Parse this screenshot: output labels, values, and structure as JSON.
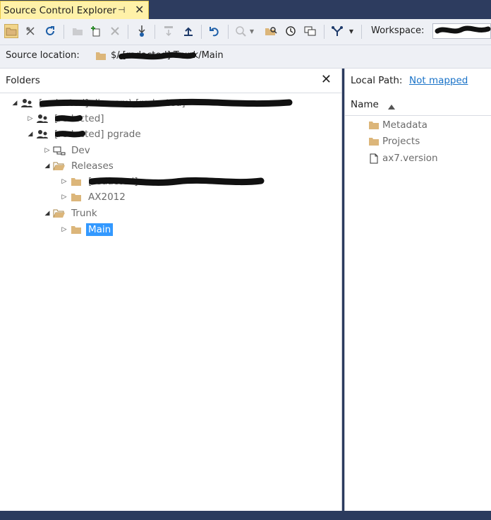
{
  "tab": {
    "title": "Source Control Explorer",
    "pin_glyph": "⊣",
    "close_glyph": "✕"
  },
  "toolbar": {
    "workspace_label": "Workspace:",
    "workspace_value": "",
    "icons": [
      "folder-view-icon",
      "disconnect-icon",
      "refresh-icon",
      "new-folder-icon",
      "add-items-icon",
      "delete-icon",
      "get-latest-icon",
      "check-in-pending-icon",
      "check-in-icon",
      "undo-icon",
      "compare-icon",
      "find-icon",
      "history-icon",
      "workspaces-icon",
      "branch-icon"
    ]
  },
  "source": {
    "label": "Source location:",
    "path": "$/ [redacted] Trunk/Main"
  },
  "folders": {
    "title": "Folders",
    "close_glyph": "✕",
    "tree": [
      {
        "label": "[redacted] dio.com\\ [redacted]",
        "icon": "team-project-collection-icon",
        "arrow": "◢",
        "expanded": true
      },
      {
        "label": "[redacted]",
        "icon": "team-project-icon",
        "arrow": "▷",
        "expanded": false
      },
      {
        "label": "[redacted] pgrade",
        "icon": "team-project-icon",
        "arrow": "◢",
        "expanded": true
      },
      {
        "label": "Dev",
        "icon": "branch-folder-icon",
        "arrow": "▷",
        "expanded": false
      },
      {
        "label": "Releases",
        "icon": "open-folder-icon",
        "arrow": "◢",
        "expanded": true
      },
      {
        "label": "[redacted]",
        "icon": "folder-icon",
        "arrow": "▷",
        "expanded": false
      },
      {
        "label": "AX2012",
        "icon": "folder-icon",
        "arrow": "▷",
        "expanded": false
      },
      {
        "label": "Trunk",
        "icon": "open-folder-icon",
        "arrow": "◢",
        "expanded": true
      },
      {
        "label": "Main",
        "icon": "folder-icon",
        "arrow": "▷",
        "expanded": false,
        "selected": true
      }
    ]
  },
  "local": {
    "label": "Local Path:",
    "link": "Not mapped",
    "column": "Name",
    "sort_glyph": "▲",
    "items": [
      {
        "name": "Metadata",
        "icon": "folder-icon"
      },
      {
        "name": "Projects",
        "icon": "folder-icon"
      },
      {
        "name": "ax7.version",
        "icon": "file-icon"
      }
    ]
  },
  "colors": {
    "folder": "#dcb67a",
    "selection": "#3399ff",
    "tab": "#fff1a8",
    "link": "#1a73c8"
  }
}
